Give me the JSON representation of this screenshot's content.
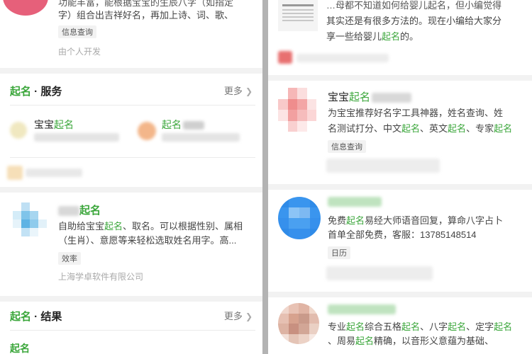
{
  "left": {
    "top_result": {
      "desc_line1": "功能丰富，能根据宝宝的生辰八字（如指定",
      "desc_line2": "字）组合出吉祥好名，再加上诗、词、歌、",
      "tag": "信息查询",
      "developer": "由个人开发"
    },
    "services": {
      "title_hl": "起名",
      "title_rest": " · 服务",
      "more": "更多",
      "item1": {
        "prefix": "宝宝",
        "hl": "起名"
      },
      "item2": {
        "hl": "起名"
      }
    },
    "app": {
      "title_hl": "起名",
      "desc_line1_a": "自助给宝宝",
      "desc_line1_hl": "起名",
      "desc_line1_b": "、取名。可以根据性别、属相",
      "desc_line2": "（生肖）、意愿等来轻松选取姓名用字。高...",
      "tag": "效率",
      "developer": "上海学卓软件有限公司"
    },
    "results": {
      "title_hl": "起名",
      "title_rest": " · 结果",
      "more": "更多",
      "bottom_hl": "起名"
    }
  },
  "right": {
    "article": {
      "line1": "…母都不知道如何给婴儿起名，但小编觉得",
      "line2": "其实还是有很多方法的。现在小编给大家分",
      "line3_a": "享一些给婴儿",
      "line3_hl": "起名",
      "line3_b": "的。"
    },
    "app1": {
      "title_a": "宝宝",
      "title_hl": "起名",
      "desc_line1": "为宝宝推荐好名字工具神器，姓名查询、姓",
      "desc_line2_a": "名测试打分、中文",
      "desc_line2_hl1": "起名",
      "desc_line2_b": "、英文",
      "desc_line2_hl2": "起名",
      "desc_line2_c": "、专家",
      "desc_line2_hl3": "起名",
      "tag": "信息查询"
    },
    "app2": {
      "desc_line1_a": "免费",
      "desc_line1_hl": "起名",
      "desc_line1_b": "易经大师语音回复，算命八字占卜",
      "desc_line2": "首单全部免费，客服：13785148514",
      "tag": "日历"
    },
    "app3": {
      "desc_line1_a": "专业",
      "desc_line1_hl1": "起名",
      "desc_line1_b": "综合五格",
      "desc_line1_hl2": "起名",
      "desc_line1_c": "、八字",
      "desc_line1_hl3": "起名",
      "desc_line1_d": "、定字",
      "desc_line1_hl4": "起名",
      "desc_line2_a": "、周易",
      "desc_line2_hl": "起名",
      "desc_line2_b": "精确，以音形义意蕴为基础、"
    }
  },
  "colors": {
    "highlight": "#3aa63a",
    "divider": "#b3b3b3"
  }
}
